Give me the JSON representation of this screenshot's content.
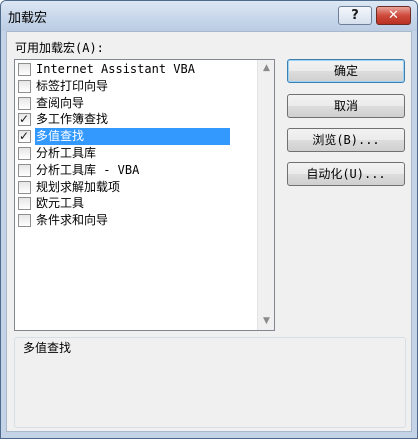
{
  "window": {
    "title": "加载宏",
    "help_glyph": "?",
    "close_glyph": "✕"
  },
  "list": {
    "label": "可用加载宏(A):",
    "items": [
      {
        "label": "Internet Assistant VBA",
        "checked": false,
        "selected": false
      },
      {
        "label": "标签打印向导",
        "checked": false,
        "selected": false
      },
      {
        "label": "查阅向导",
        "checked": false,
        "selected": false
      },
      {
        "label": "多工作簿查找",
        "checked": true,
        "selected": false
      },
      {
        "label": "多值查找",
        "checked": true,
        "selected": true
      },
      {
        "label": "分析工具库",
        "checked": false,
        "selected": false
      },
      {
        "label": "分析工具库 - VBA",
        "checked": false,
        "selected": false
      },
      {
        "label": "规划求解加载项",
        "checked": false,
        "selected": false
      },
      {
        "label": "欧元工具",
        "checked": false,
        "selected": false
      },
      {
        "label": "条件求和向导",
        "checked": false,
        "selected": false
      }
    ],
    "check_glyph": "✓",
    "scroll_up_glyph": "▲",
    "scroll_down_glyph": "▼"
  },
  "buttons": {
    "ok": "确定",
    "cancel": "取消",
    "browse": "浏览(B)...",
    "automation": "自动化(U)..."
  },
  "description": {
    "title": "多值查找"
  }
}
